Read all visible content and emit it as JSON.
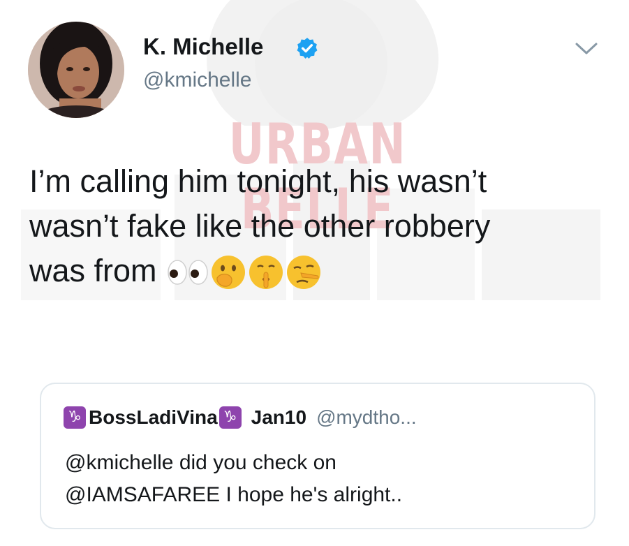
{
  "watermark": {
    "text": "URBAN BELLE"
  },
  "author": {
    "display_name": "K. Michelle",
    "handle": "@kmichelle",
    "verified": true,
    "verified_icon": "verified-badge-icon",
    "avatar_icon": "profile-photo"
  },
  "menu": {
    "icon": "chevron-down-icon"
  },
  "tweet": {
    "lines": [
      "I’m calling him tonight, his wasn’t",
      "wasn’t fake like the other robbery",
      "was from"
    ],
    "emojis": [
      "eyes-emoji",
      "face-with-hand-over-mouth-emoji",
      "shushing-face-emoji",
      "lying-face-emoji"
    ]
  },
  "quoted_tweet": {
    "zodiac_left": "♑",
    "zodiac_right": "♑",
    "name": "BossLadiVina",
    "date": "Jan10",
    "handle": "@mydtho...",
    "lines": [
      "@kmichelle did you check on",
      "@IAMSAFAREE I hope he's alright.."
    ]
  },
  "colors": {
    "text_primary": "#14171a",
    "text_secondary": "#657786",
    "verified_blue": "#1da1f2",
    "watermark_pink": "#f1c8cb",
    "card_border": "#e1e8ed",
    "zodiac_purple": "#8e44ad"
  }
}
